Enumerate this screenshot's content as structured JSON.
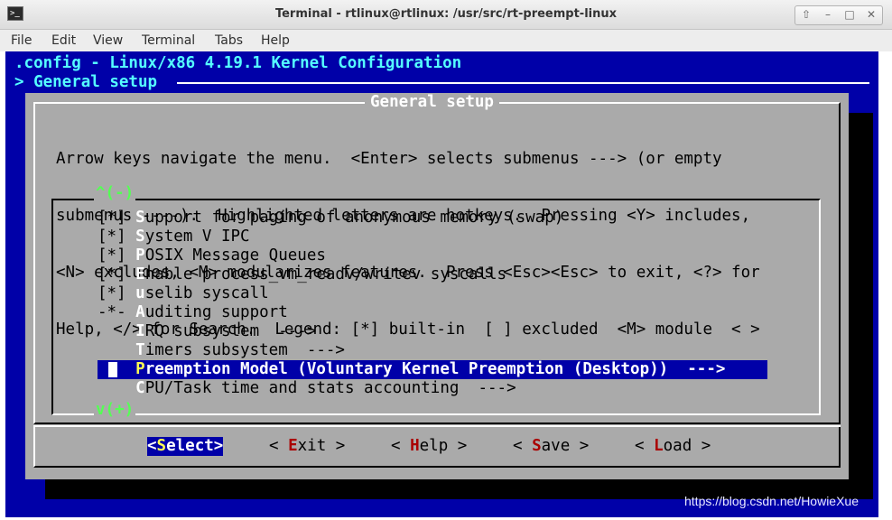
{
  "window": {
    "icon_glyph": ">_",
    "title": "Terminal - rtlinux@rtlinux: /usr/src/rt-preempt-linux",
    "buttons": [
      "⇧",
      "–",
      "□",
      "✕"
    ]
  },
  "menubar": {
    "items": [
      "File",
      "Edit",
      "View",
      "Terminal",
      "Tabs",
      "Help"
    ]
  },
  "terminal": {
    "header": ".config - Linux/x86 4.19.1 Kernel Configuration",
    "breadcrumb": "> General setup",
    "dialog_title": "General setup",
    "help_lines": [
      "Arrow keys navigate the menu.  <Enter> selects submenus ---> (or empty",
      "submenus ----).  Highlighted letters are hotkeys.  Pressing <Y> includes,",
      "<N> excludes, <M> modularizes features.  Press <Esc><Esc> to exit, <?> for",
      "Help, </> for Search.  Legend: [*] built-in  [ ] excluded  <M> module  < >"
    ],
    "scroll_up": "^(-)",
    "scroll_down": "v(+)",
    "items": [
      {
        "prefix": "[*] ",
        "hotkey": "S",
        "rest": "upport for paging of anonymous memory (swap)"
      },
      {
        "prefix": "[*] ",
        "hotkey": "S",
        "rest": "ystem V IPC"
      },
      {
        "prefix": "[*] ",
        "hotkey": "P",
        "rest": "OSIX Message Queues"
      },
      {
        "prefix": "[*] ",
        "hotkey": "E",
        "rest": "nable process_vm_readv/writev syscalls"
      },
      {
        "prefix": "[*] ",
        "hotkey": "u",
        "rest": "selib syscall"
      },
      {
        "prefix": "-*- ",
        "hotkey": "A",
        "rest": "uditing support"
      },
      {
        "prefix": "    ",
        "hotkey": "I",
        "rest": "RQ subsystem  --->"
      },
      {
        "prefix": "    ",
        "hotkey": "T",
        "rest": "imers subsystem  --->"
      },
      {
        "prefix": "    ",
        "hotkey": "P",
        "rest": "reemption Model (Voluntary Kernel Preemption (Desktop))  --->"
      },
      {
        "prefix": "    ",
        "hotkey": "C",
        "rest": "PU/Task time and stats accounting  --->"
      }
    ],
    "buttons": [
      {
        "pre": "<",
        "hotkey": "S",
        "rest": "elect>"
      },
      {
        "pre": "< ",
        "hotkey": "E",
        "rest": "xit >"
      },
      {
        "pre": "< ",
        "hotkey": "H",
        "rest": "elp >"
      },
      {
        "pre": "< ",
        "hotkey": "S",
        "rest": "ave >"
      },
      {
        "pre": "< ",
        "hotkey": "L",
        "rest": "oad >"
      }
    ]
  },
  "watermark": "https://blog.csdn.net/HowieXue",
  "colors": {
    "terminal_bg": "#0000a8",
    "dialog_bg": "#aaaaaa",
    "highlight_bg": "#0000a8",
    "hotkey_text": "#ffffff",
    "button_hotkey": "#aa0000",
    "scroll_indicator": "#55ff55",
    "header_text": "#55ffff"
  }
}
